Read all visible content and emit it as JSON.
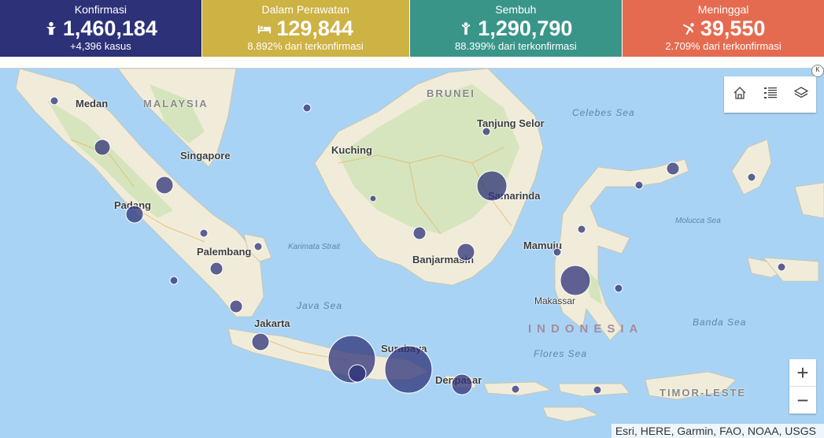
{
  "stats": [
    {
      "label": "Konfirmasi",
      "value": "1,460,184",
      "sub": "+4,396 kasus",
      "icon": "confirmed-person-icon",
      "color": "#2d3178"
    },
    {
      "label": "Dalam Perawatan",
      "value": "129,844",
      "sub": "8.892% dari terkonfirmasi",
      "icon": "hospital-bed-icon",
      "color": "#cdb244"
    },
    {
      "label": "Sembuh",
      "value": "1,290,790",
      "sub": "88.399% dari terkonfirmasi",
      "icon": "recovered-person-icon",
      "color": "#3a9589"
    },
    {
      "label": "Meninggal",
      "value": "39,550",
      "sub": "2.709% dari terkonfirmasi",
      "icon": "deceased-person-icon",
      "color": "#e56b50"
    }
  ],
  "map": {
    "cities": [
      "Medan",
      "Singapore",
      "Padang",
      "Palembang",
      "Jakarta",
      "Kuching",
      "Tanjung Selor",
      "Samarinda",
      "Banjarmasin",
      "Mamuju",
      "Makassar",
      "Surabaya",
      "Denpasar"
    ],
    "countries": [
      "MALAYSIA",
      "BRUNEI",
      "TIMOR-LESTE"
    ],
    "country_main": "INDONESIA",
    "seas": [
      "Celebes Sea",
      "Molucca Sea",
      "Karimata Strait",
      "Java Sea",
      "Flores Sea",
      "Banda Sea"
    ],
    "bubble_color": "#2d3178",
    "attribution": "Esri, HERE, Garmin, FAO, NOAA, USGS"
  },
  "controls": {
    "home_icon": "home-icon",
    "legend_icon": "legend-list-icon",
    "layers_icon": "layers-icon",
    "zoom_in": "+",
    "zoom_out": "−",
    "collapse_label": "K"
  }
}
